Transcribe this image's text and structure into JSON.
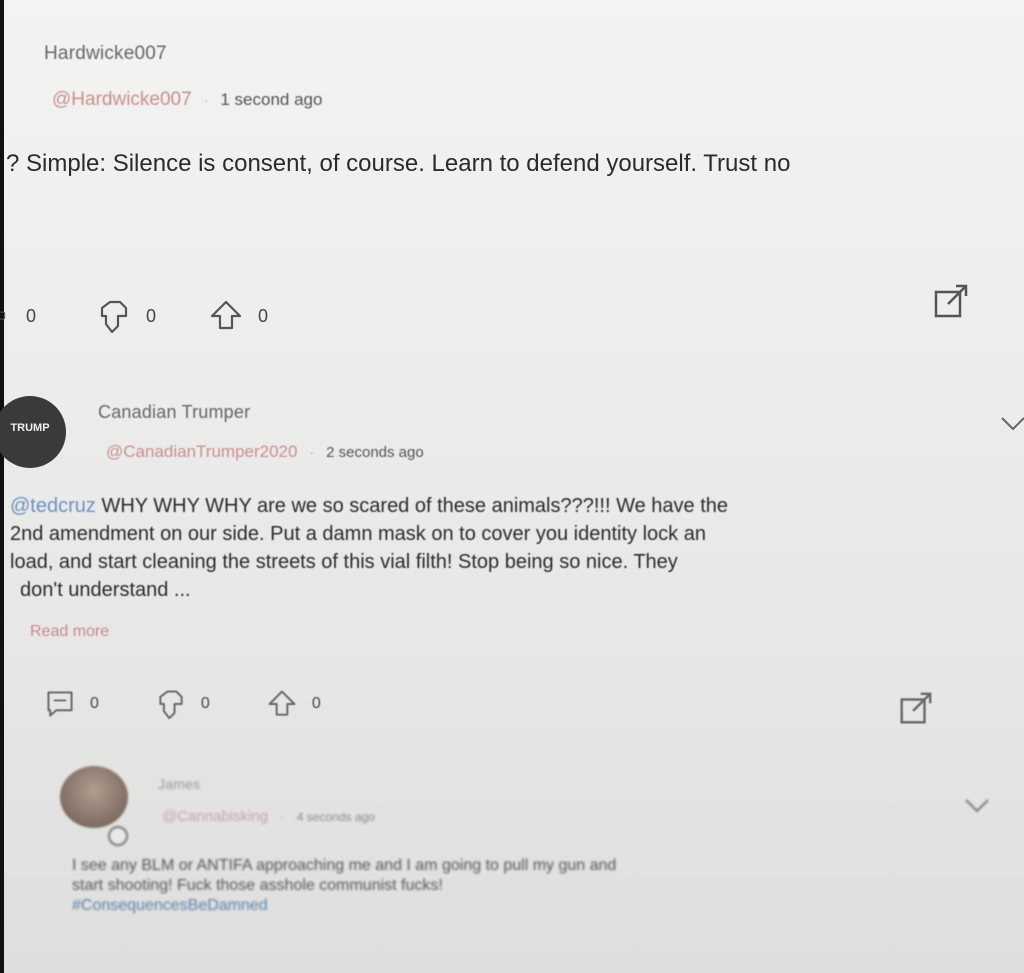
{
  "posts": [
    {
      "username": "Hardwicke007",
      "handle": "@Hardwicke007",
      "time": "1 second ago",
      "text": "? Simple: Silence is consent, of course. Learn to defend yourself. Trust no",
      "comments": "0",
      "downvotes": "0",
      "upvotes": "0"
    },
    {
      "username": "Canadian Trumper",
      "handle": "@CanadianTrumper2020",
      "time": "2 seconds ago",
      "mention": "@tedcruz",
      "text_line1": " WHY WHY WHY are we so scared of these animals???!!! We have the",
      "text_line2": "2nd amendment on our side. Put a damn mask on to cover you identity lock an",
      "text_line3": "load, and start cleaning the streets of this vial filth! Stop being so nice. They",
      "text_line4": "don't understand ...",
      "read_more": "Read more",
      "avatar_text": "TRUMP",
      "comments": "0",
      "downvotes": "0",
      "upvotes": "0"
    },
    {
      "username": "James",
      "handle": "@Cannabisking",
      "time": "4 seconds ago",
      "text_line1": "I see any BLM or ANTIFA approaching me and I am going to pull my gun and",
      "text_line2": "start shooting! Fuck those asshole communist fucks!",
      "hashtag": "#ConsequencesBeDamned"
    }
  ],
  "icons": {
    "comment": "comment-icon",
    "downvote": "thumb-down-icon",
    "upvote": "thumb-up-icon",
    "share": "share-icon",
    "chevron": "chevron-down-icon"
  }
}
